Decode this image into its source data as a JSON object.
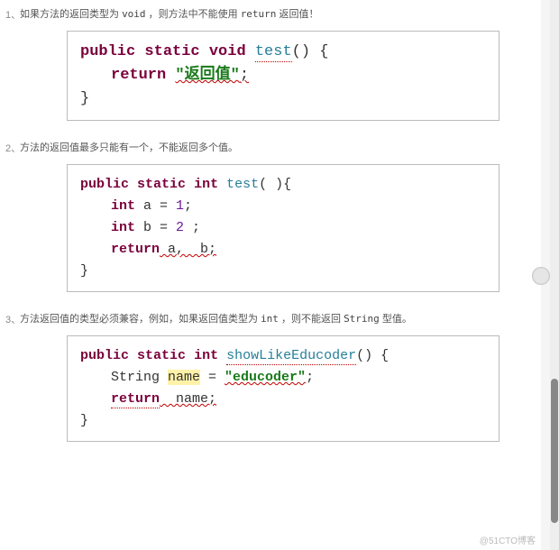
{
  "items": [
    {
      "num": "1、",
      "text_a": "如果方法的返回类型为 ",
      "code_a": "void",
      "text_b": " ，则方法中不能使用 ",
      "code_b": "return",
      "text_c": " 返回值！"
    },
    {
      "num": "2、",
      "text_a": "方法的返回值最多只能有一个，不能返回多个值。",
      "code_a": "",
      "text_b": "",
      "code_b": "",
      "text_c": ""
    },
    {
      "num": "3、",
      "text_a": "方法返回值的类型必须兼容，例如，如果返回值类型为 ",
      "code_a": "int",
      "text_b": " ，则不能返回 ",
      "code_b": "String",
      "text_c": " 型值。"
    }
  ],
  "code1": {
    "kw_public": "public",
    "kw_static": "static",
    "kw_void": "void",
    "fname": "test",
    "parens": "() {",
    "kw_return": "return",
    "str": "\"返回值\"",
    "semi": ";",
    "close": "}"
  },
  "code2": {
    "kw_public": "public",
    "kw_static": "static",
    "kw_int": "int",
    "fname": "test",
    "parens": "( ){",
    "kw_int_a": "int",
    "var_a": " a = ",
    "lit_a": "1",
    "semi_a": ";",
    "kw_int_b": "int",
    "var_b": " b = ",
    "lit_b": "2",
    "semi_b": " ;",
    "kw_return": "return",
    "ret_expr": " a,  b;",
    "close": "}"
  },
  "code3": {
    "kw_public": "public",
    "kw_static": "static",
    "kw_int": "int",
    "fname": "showLikeEducoder",
    "parens": "() {",
    "type_string": "String ",
    "var_name": "name",
    "eq": " = ",
    "str": "\"educoder\"",
    "semi1": ";",
    "kw_return": "return",
    "ret_var": "  name;",
    "close": "}"
  },
  "watermark": "@51CTO博客"
}
